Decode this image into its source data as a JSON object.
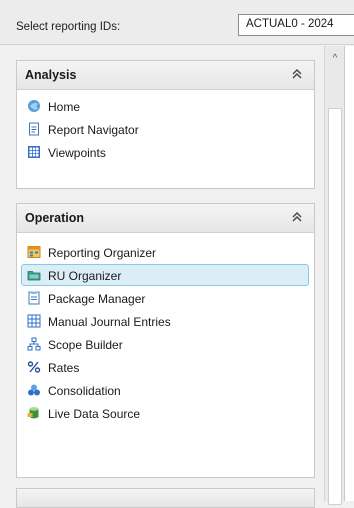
{
  "topbar": {
    "label": "Select reporting IDs:",
    "combo_value": "ACTUAL0 - 2024"
  },
  "panels": {
    "analysis": {
      "title": "Analysis",
      "items": [
        {
          "label": "Home",
          "icon": "home-icon"
        },
        {
          "label": "Report Navigator",
          "icon": "document-icon"
        },
        {
          "label": "Viewpoints",
          "icon": "grid-icon"
        }
      ]
    },
    "operation": {
      "title": "Operation",
      "items": [
        {
          "label": "Reporting Organizer",
          "icon": "organizer-icon"
        },
        {
          "label": "RU Organizer",
          "icon": "folder-icon",
          "selected": true
        },
        {
          "label": "Package Manager",
          "icon": "package-icon"
        },
        {
          "label": "Manual Journal Entries",
          "icon": "journal-icon"
        },
        {
          "label": "Scope Builder",
          "icon": "hierarchy-icon"
        },
        {
          "label": "Rates",
          "icon": "percent-icon"
        },
        {
          "label": "Consolidation",
          "icon": "consolidation-icon"
        },
        {
          "label": "Live Data Source",
          "icon": "database-icon"
        }
      ]
    }
  },
  "colors": {
    "selection_bg": "#dbeef8",
    "selection_border": "#8cc7e6",
    "panel_header": "#e6e6e6"
  }
}
